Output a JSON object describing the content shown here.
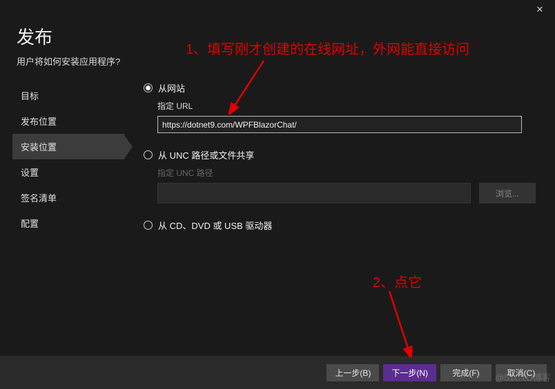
{
  "header": {
    "title": "发布",
    "subtitle": "用户将如何安装应用程序?"
  },
  "sidebar": {
    "items": [
      {
        "label": "目标"
      },
      {
        "label": "发布位置"
      },
      {
        "label": "安装位置"
      },
      {
        "label": "设置"
      },
      {
        "label": "签名清单"
      },
      {
        "label": "配置"
      }
    ]
  },
  "options": {
    "website": {
      "label": "从网站",
      "field_label": "指定 URL",
      "value": "https://dotnet9.com/WPFBlazorChat/"
    },
    "unc": {
      "label": "从 UNC 路径或文件共享",
      "field_label": "指定 UNC 路径",
      "placeholder": "",
      "browse": "浏览..."
    },
    "cd": {
      "label": "从 CD、DVD 或 USB 驱动器"
    }
  },
  "footer": {
    "back": "上一步(B)",
    "next": "下一步(N)",
    "finish": "完成(F)",
    "cancel": "取消(C)"
  },
  "annotations": {
    "line1": "1、填写刚才创建的在线网址，外网能直接访问",
    "line2": "2、点它"
  },
  "watermark": "@51CTO博客"
}
